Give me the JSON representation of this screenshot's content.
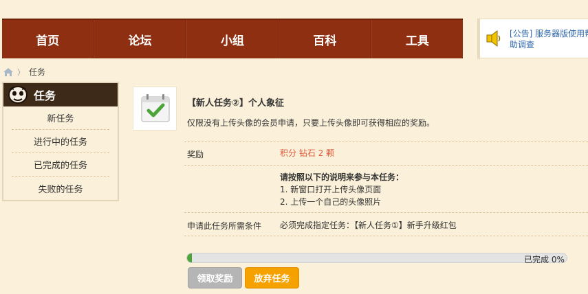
{
  "nav": {
    "items": [
      "首页",
      "论坛",
      "小组",
      "百科",
      "工具"
    ]
  },
  "notice": {
    "text": "[公告] 服务器版使用帮助调查"
  },
  "breadcrumb": {
    "current": "任务"
  },
  "sidebar": {
    "title": "任务",
    "items": [
      "新任务",
      "进行中的任务",
      "已完成的任务",
      "失败的任务"
    ]
  },
  "task": {
    "title": "【新人任务②】个人象征",
    "description": "仅限没有上传头像的会员申请，只要上传头像即可获得相应的奖励。",
    "reward_label": "奖励",
    "reward_value": "积分 钻石 2 颗",
    "instructions_title": "请按照以下的说明来参与本任务：",
    "instructions": [
      "1. 新窗口打开上传头像页面",
      "2. 上传一个自己的头像照片"
    ],
    "condition_label": "申请此任务所需条件",
    "condition_value": "必须完成指定任务：【新人任务①】新手升级红包",
    "progress_percent": 0,
    "progress_text": "已完成 0%",
    "claim_button": "领取奖励",
    "abandon_button": "放弃任务"
  }
}
